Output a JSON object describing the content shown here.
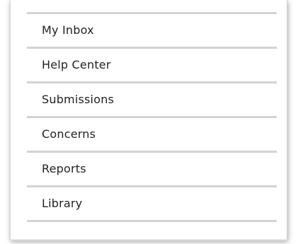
{
  "menu": {
    "items": [
      {
        "label": "My Inbox"
      },
      {
        "label": "Help Center"
      },
      {
        "label": "Submissions"
      },
      {
        "label": "Concerns"
      },
      {
        "label": "Reports"
      },
      {
        "label": "Library"
      }
    ]
  },
  "colors": {
    "divider": "#d3d3d3",
    "text": "#222222",
    "background": "#ffffff"
  }
}
